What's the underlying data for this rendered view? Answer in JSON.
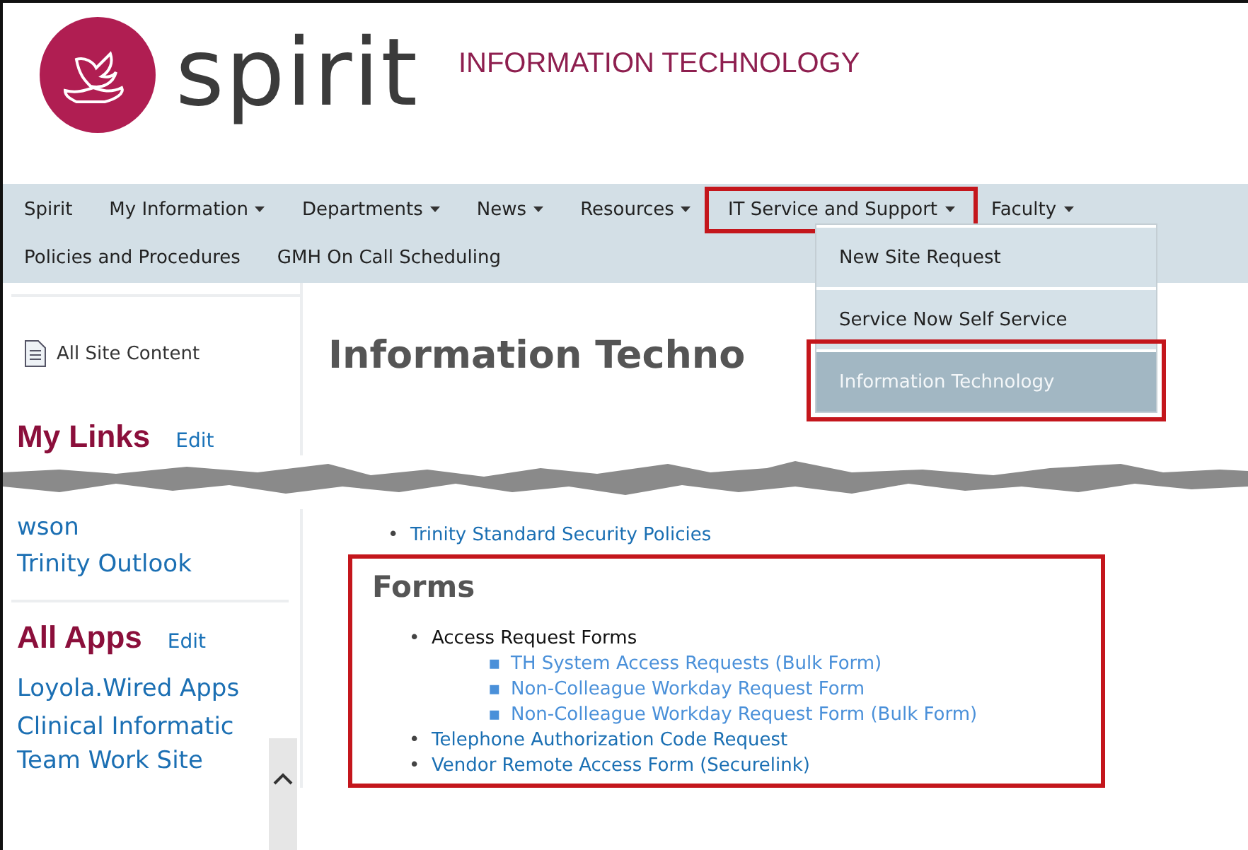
{
  "header": {
    "logo_text": "spirit",
    "site_title": "INFORMATION TECHNOLOGY"
  },
  "nav": {
    "primary": [
      {
        "label": "Spirit",
        "caret": false,
        "highlighted": false
      },
      {
        "label": "My Information",
        "caret": true,
        "highlighted": false
      },
      {
        "label": "Departments",
        "caret": true,
        "highlighted": false
      },
      {
        "label": "News",
        "caret": true,
        "highlighted": false
      },
      {
        "label": "Resources",
        "caret": true,
        "highlighted": false
      },
      {
        "label": "IT Service and Support",
        "caret": true,
        "highlighted": true
      },
      {
        "label": "Faculty",
        "caret": true,
        "highlighted": false
      }
    ],
    "secondary": [
      {
        "label": "Policies and Procedures",
        "caret": false,
        "highlighted": false
      },
      {
        "label": "GMH On Call Scheduling",
        "caret": false,
        "highlighted": false
      }
    ]
  },
  "dropdown": {
    "items": [
      {
        "label": "New Site Request",
        "selected": false,
        "highlighted": false
      },
      {
        "label": "Service Now Self Service",
        "selected": false,
        "highlighted": false
      },
      {
        "label": "Information Technology",
        "selected": true,
        "highlighted": true
      }
    ]
  },
  "sidebar": {
    "all_site_content": "All Site Content",
    "my_links": {
      "title": "My Links",
      "edit": "Edit",
      "items": [
        "wson",
        "Trinity Outlook"
      ]
    },
    "all_apps": {
      "title": "All Apps",
      "edit": "Edit",
      "items": [
        "Loyola.Wired Apps",
        "Clinical Informatic",
        "Team Work Site"
      ]
    }
  },
  "main": {
    "title": "Information Techno",
    "policy_link": {
      "marker": "•",
      "label": "Trinity Standard Security Policies"
    },
    "forms": {
      "title": "Forms",
      "highlighted": true,
      "items": [
        {
          "marker": "•",
          "label": "Access Request Forms",
          "kind": "text",
          "children": [
            {
              "marker": "▪",
              "label": "TH System Access Requests (Bulk Form)"
            },
            {
              "marker": "▪",
              "label": "Non-Colleague Workday Request Form"
            },
            {
              "marker": "▪",
              "label": "Non-Colleague Workday Request Form (Bulk Form)"
            }
          ]
        },
        {
          "marker": "•",
          "label": "Telephone Authorization Code Request",
          "kind": "link"
        },
        {
          "marker": "•",
          "label": "Vendor Remote Access Form (Securelink)",
          "kind": "link"
        }
      ]
    }
  }
}
